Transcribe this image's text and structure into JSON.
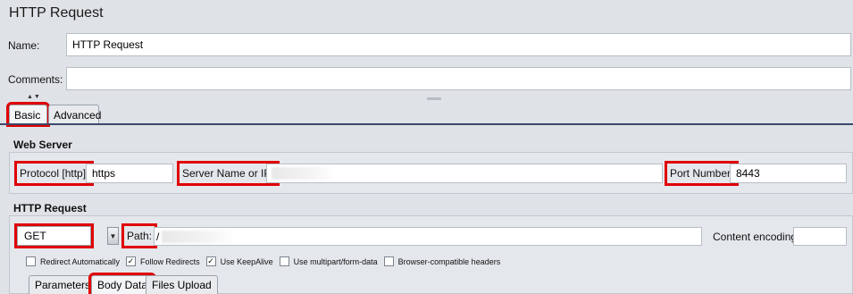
{
  "panel": {
    "title": "HTTP Request"
  },
  "name_row": {
    "label": "Name:",
    "value": "HTTP Request"
  },
  "comments_row": {
    "label": "Comments:",
    "value": ""
  },
  "tabs": [
    {
      "label": "Basic",
      "active": true,
      "highlighted": true
    },
    {
      "label": "Advanced",
      "active": false,
      "highlighted": false
    }
  ],
  "web_server": {
    "title": "Web Server",
    "protocol_label": "Protocol [http]:",
    "protocol_value": "https",
    "server_label": "Server Name or IP:",
    "server_value": "",
    "port_label": "Port Number:",
    "port_value": "8443"
  },
  "http_request": {
    "title": "HTTP Request",
    "method": "GET",
    "path_label": "Path:",
    "path_value": "/",
    "encoding_label": "Content encoding:",
    "encoding_value": "",
    "checkboxes": [
      {
        "label": "Redirect Automatically",
        "checked": false
      },
      {
        "label": "Follow Redirects",
        "checked": true
      },
      {
        "label": "Use KeepAlive",
        "checked": true
      },
      {
        "label": "Use multipart/form-data",
        "checked": false
      },
      {
        "label": "Browser-compatible headers",
        "checked": false
      }
    ],
    "subtabs": [
      {
        "label": "Parameters",
        "highlighted": false
      },
      {
        "label": "Body Data",
        "highlighted": true
      },
      {
        "label": "Files Upload",
        "highlighted": false
      }
    ]
  },
  "colors": {
    "highlight": "#e00000",
    "background": "#dfe2e6"
  }
}
